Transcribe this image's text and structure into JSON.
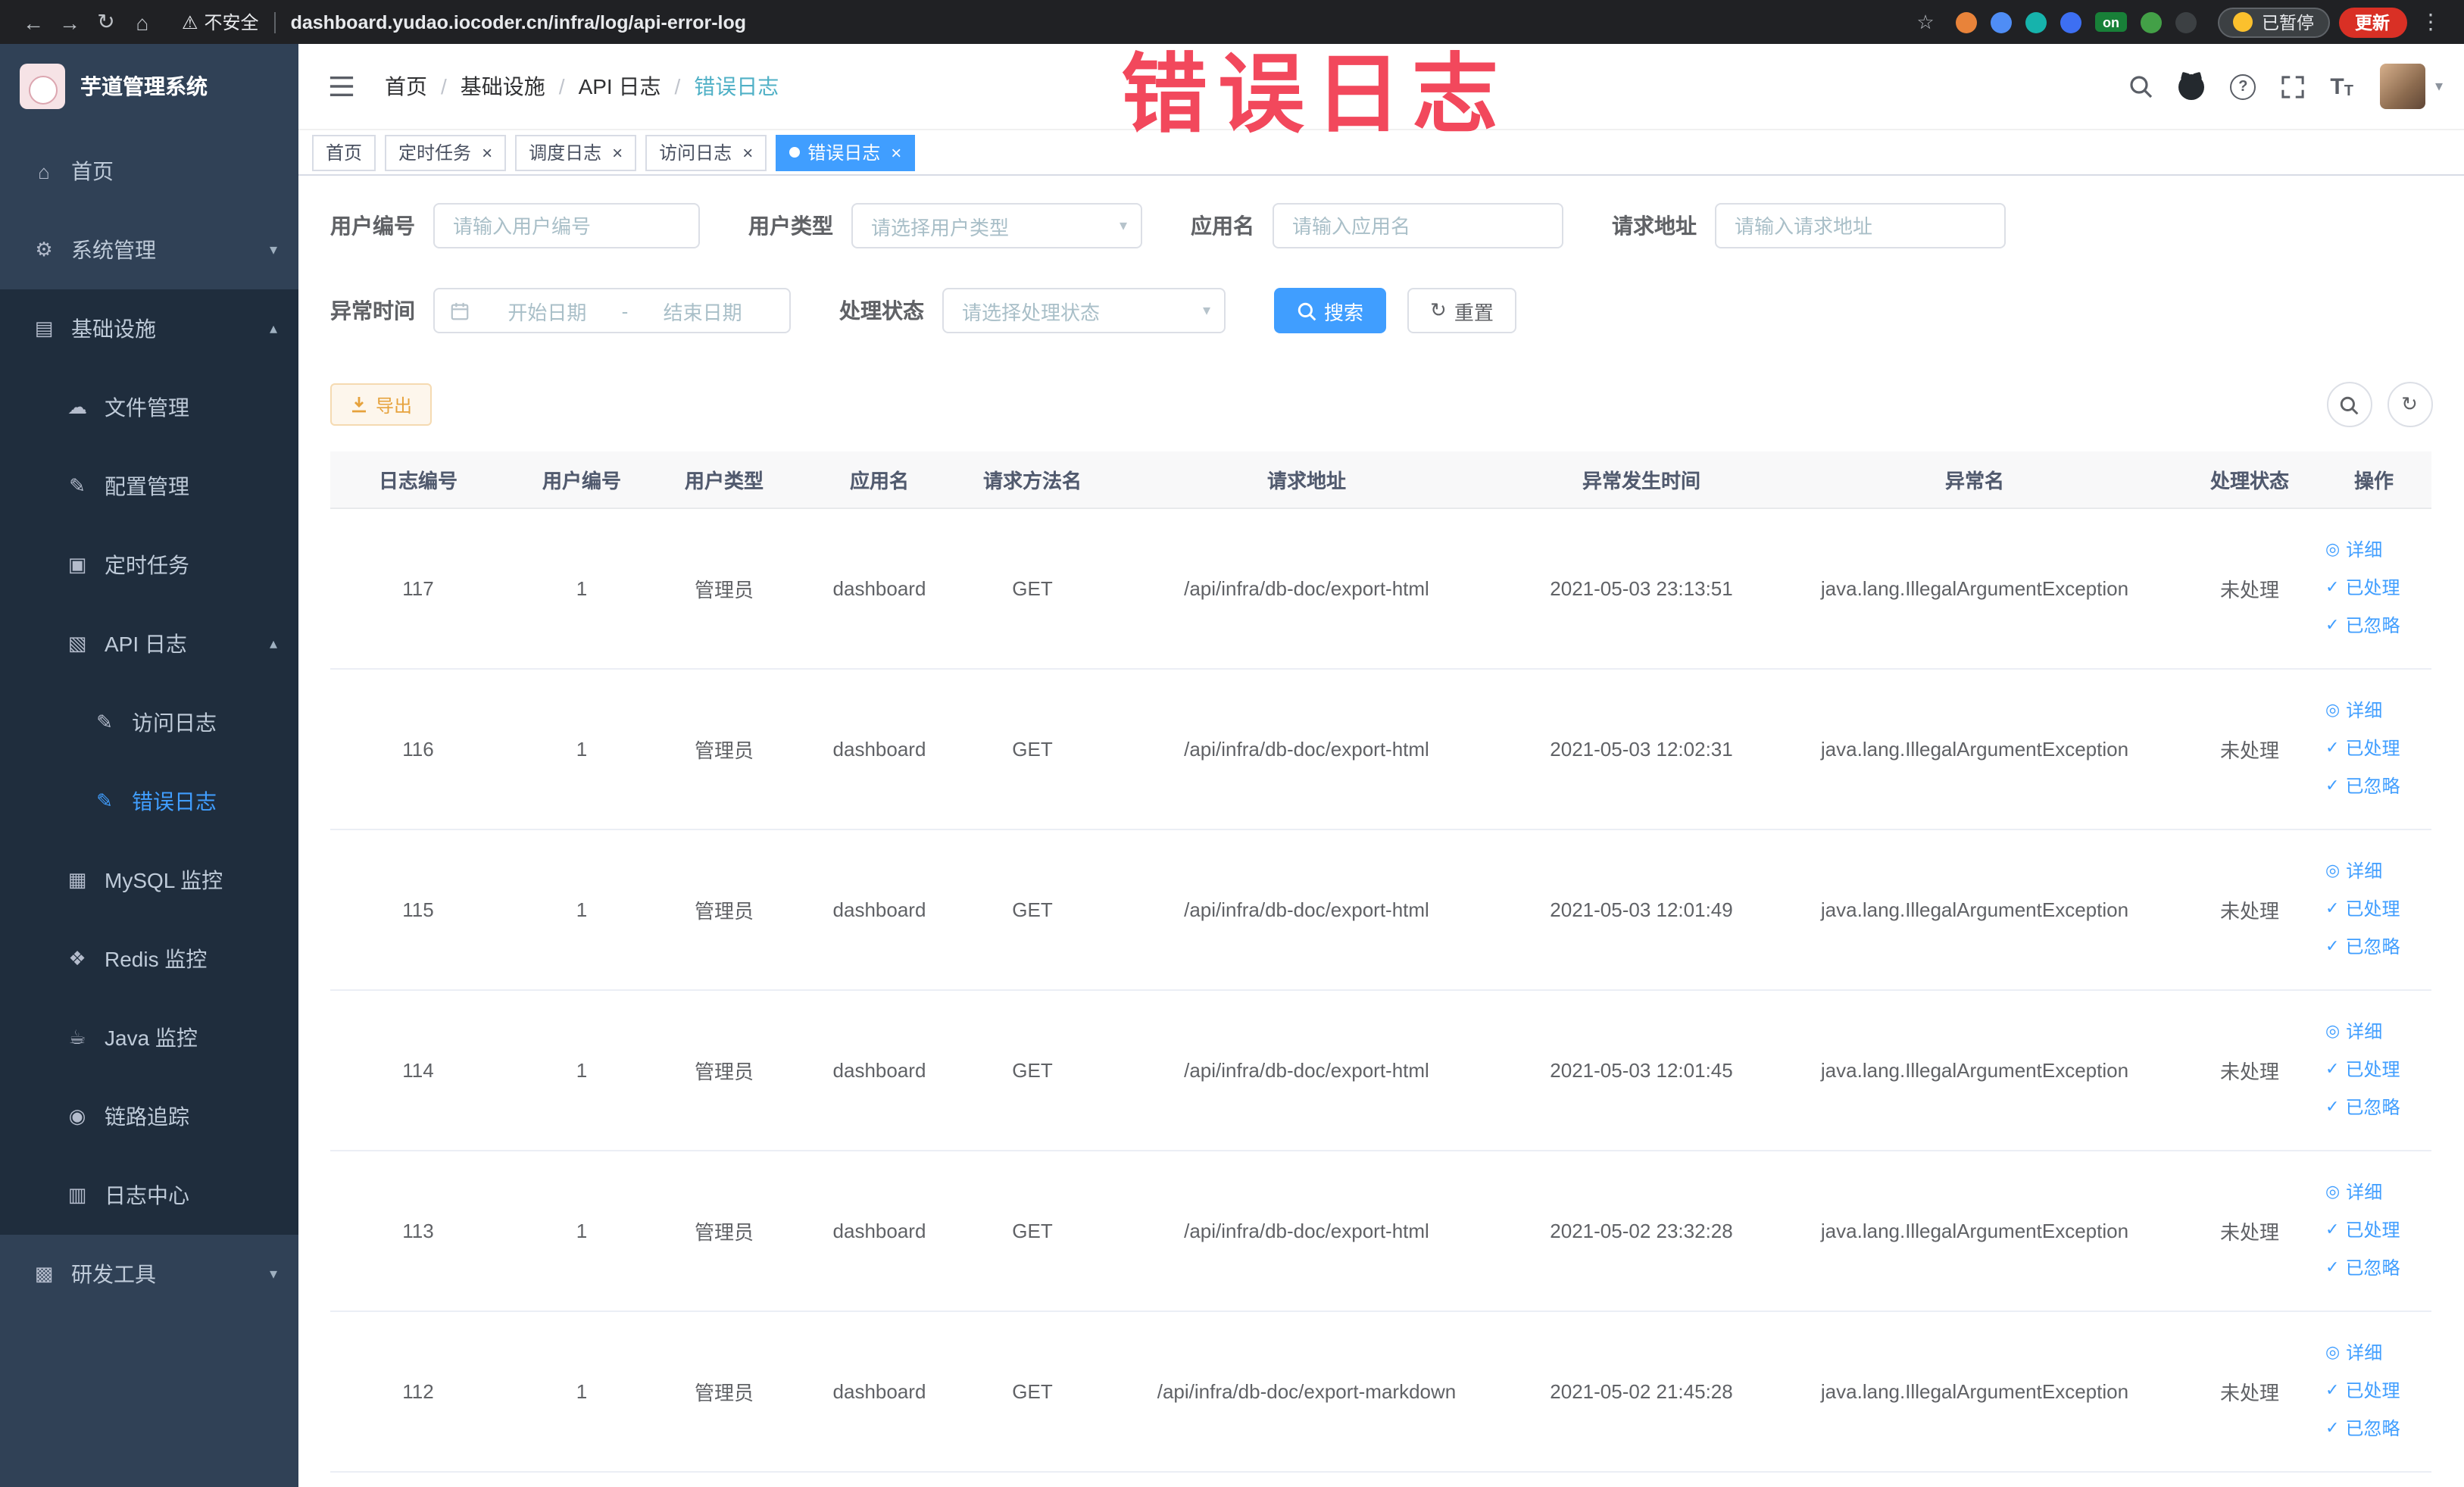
{
  "colors": {
    "accent": "#409eff",
    "sidebar_bg": "#304156",
    "submenu_bg": "#1f2d3d",
    "warning": "#e6a23c",
    "tab_active": "#409eff",
    "watermark": "#f2485c"
  },
  "browser": {
    "security_label": "不安全",
    "url": "dashboard.yudao.iocoder.cn/infra/log/api-error-log",
    "paused_badge": "已暂停",
    "update_button": "更新",
    "extensions": [
      {
        "key": "orange",
        "color": "#e8833a"
      },
      {
        "key": "blue",
        "color": "#4f8df5"
      },
      {
        "key": "teal",
        "color": "#16b3ac"
      },
      {
        "key": "indigo",
        "color": "#3d6ff2"
      },
      {
        "key": "on-badge",
        "color": "#188038",
        "label": "on"
      },
      {
        "key": "green",
        "color": "#43a047"
      },
      {
        "key": "dark",
        "color": "#3c4043"
      }
    ]
  },
  "watermark": {
    "text": "错误日志",
    "color": "#f2485c"
  },
  "sidebar": {
    "logo_title": "芋道管理系统",
    "menu": [
      {
        "key": "home",
        "label": "首页",
        "icon": "home-icon",
        "level": 0
      },
      {
        "key": "system",
        "label": "系统管理",
        "icon": "gear-icon",
        "level": 0,
        "chevron": "down"
      },
      {
        "key": "infra",
        "label": "基础设施",
        "icon": "infra-icon",
        "level": 0,
        "chevron": "up",
        "dark": true
      },
      {
        "key": "file",
        "label": "文件管理",
        "icon": "cloud-icon",
        "level": 1
      },
      {
        "key": "config",
        "label": "配置管理",
        "icon": "edit-icon",
        "level": 1
      },
      {
        "key": "job",
        "label": "定时任务",
        "icon": "task-icon",
        "level": 1
      },
      {
        "key": "api-log",
        "label": "API 日志",
        "icon": "api-log-icon",
        "level": 1,
        "chevron": "up"
      },
      {
        "key": "access-log",
        "label": "访问日志",
        "icon": "doc-edit-icon",
        "level": 2
      },
      {
        "key": "error-log",
        "label": "错误日志",
        "icon": "doc-edit-icon",
        "level": 2,
        "active": true
      },
      {
        "key": "mysql",
        "label": "MySQL 监控",
        "icon": "database-icon",
        "level": 1
      },
      {
        "key": "redis",
        "label": "Redis 监控",
        "icon": "redis-icon",
        "level": 1
      },
      {
        "key": "java",
        "label": "Java 监控",
        "icon": "java-icon",
        "level": 1
      },
      {
        "key": "trace",
        "label": "链路追踪",
        "icon": "trace-icon",
        "level": 1
      },
      {
        "key": "log-center",
        "label": "日志中心",
        "icon": "log-center-icon",
        "level": 1
      },
      {
        "key": "dev-tools",
        "label": "研发工具",
        "icon": "tools-icon",
        "level": 0,
        "chevron": "down"
      }
    ]
  },
  "header": {
    "breadcrumbs": [
      "首页",
      "基础设施",
      "API 日志",
      "错误日志"
    ]
  },
  "tabs": [
    {
      "key": "home",
      "label": "首页",
      "closable": false,
      "active": false
    },
    {
      "key": "job",
      "label": "定时任务",
      "closable": true,
      "active": false
    },
    {
      "key": "job-log",
      "label": "调度日志",
      "closable": true,
      "active": false
    },
    {
      "key": "access-log",
      "label": "访问日志",
      "closable": true,
      "active": false
    },
    {
      "key": "error-log",
      "label": "错误日志",
      "closable": true,
      "active": true
    }
  ],
  "filters": {
    "user_id_label": "用户编号",
    "user_id_placeholder": "请输入用户编号",
    "user_type_label": "用户类型",
    "user_type_placeholder": "请选择用户类型",
    "app_name_label": "应用名",
    "app_name_placeholder": "请输入应用名",
    "request_url_label": "请求地址",
    "request_url_placeholder": "请输入请求地址",
    "exception_time_label": "异常时间",
    "start_date_placeholder": "开始日期",
    "end_date_placeholder": "结束日期",
    "range_separator": "-",
    "process_status_label": "处理状态",
    "process_status_placeholder": "请选择处理状态",
    "search_button": "搜索",
    "reset_button": "重置"
  },
  "toolbar": {
    "export_button": "导出"
  },
  "table": {
    "columns": [
      "日志编号",
      "用户编号",
      "用户类型",
      "应用名",
      "请求方法名",
      "请求地址",
      "异常发生时间",
      "异常名",
      "处理状态",
      "操作"
    ],
    "actions": [
      "详细",
      "已处理",
      "已忽略"
    ],
    "rows": [
      {
        "id": "117",
        "user_id": "1",
        "user_type": "管理员",
        "app": "dashboard",
        "method": "GET",
        "url": "/api/infra/db-doc/export-html",
        "time": "2021-05-03 23:13:51",
        "exception": "java.lang.IllegalArgumentException",
        "status": "未处理"
      },
      {
        "id": "116",
        "user_id": "1",
        "user_type": "管理员",
        "app": "dashboard",
        "method": "GET",
        "url": "/api/infra/db-doc/export-html",
        "time": "2021-05-03 12:02:31",
        "exception": "java.lang.IllegalArgumentException",
        "status": "未处理"
      },
      {
        "id": "115",
        "user_id": "1",
        "user_type": "管理员",
        "app": "dashboard",
        "method": "GET",
        "url": "/api/infra/db-doc/export-html",
        "time": "2021-05-03 12:01:49",
        "exception": "java.lang.IllegalArgumentException",
        "status": "未处理"
      },
      {
        "id": "114",
        "user_id": "1",
        "user_type": "管理员",
        "app": "dashboard",
        "method": "GET",
        "url": "/api/infra/db-doc/export-html",
        "time": "2021-05-03 12:01:45",
        "exception": "java.lang.IllegalArgumentException",
        "status": "未处理"
      },
      {
        "id": "113",
        "user_id": "1",
        "user_type": "管理员",
        "app": "dashboard",
        "method": "GET",
        "url": "/api/infra/db-doc/export-html",
        "time": "2021-05-02 23:32:28",
        "exception": "java.lang.IllegalArgumentException",
        "status": "未处理"
      },
      {
        "id": "112",
        "user_id": "1",
        "user_type": "管理员",
        "app": "dashboard",
        "method": "GET",
        "url": "/api/infra/db-doc/export-markdown",
        "time": "2021-05-02 21:45:28",
        "exception": "java.lang.IllegalArgumentException",
        "status": "未处理"
      }
    ]
  }
}
